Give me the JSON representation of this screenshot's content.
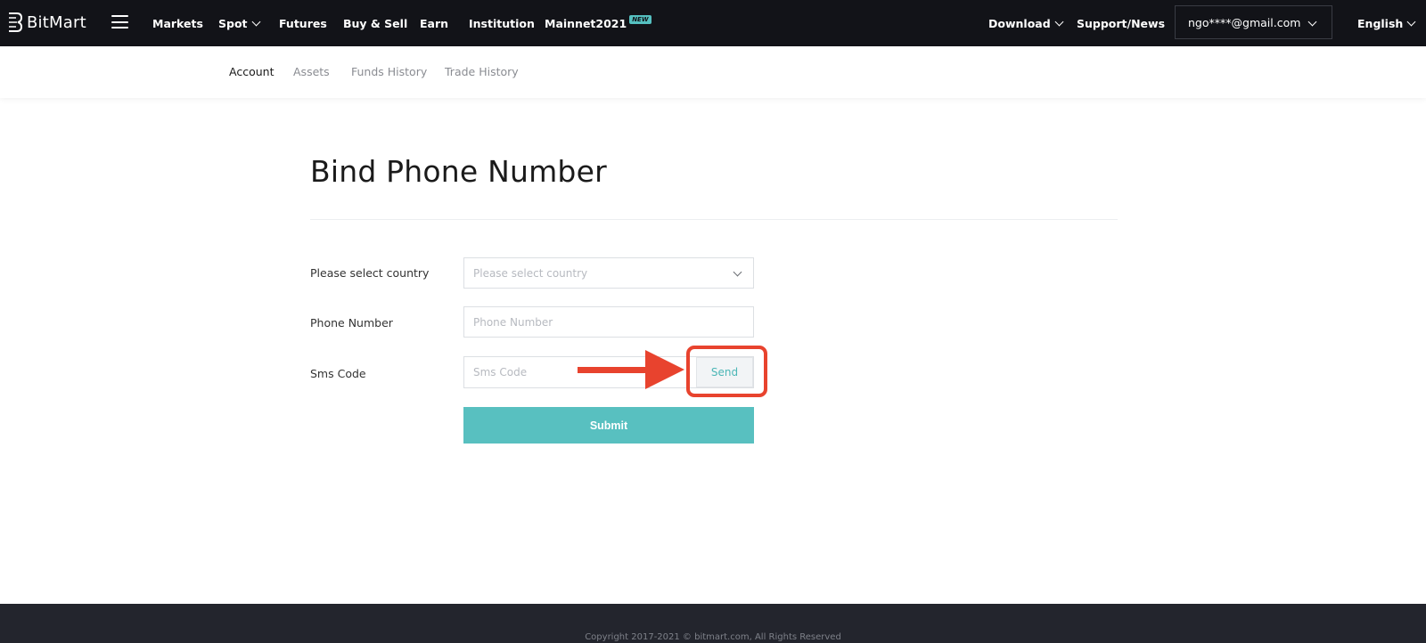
{
  "brand": {
    "name": "BitMart"
  },
  "topnav": {
    "items": [
      {
        "label": "Markets"
      },
      {
        "label": "Spot"
      },
      {
        "label": "Futures"
      },
      {
        "label": "Buy & Sell"
      },
      {
        "label": "Earn"
      },
      {
        "label": "Institution"
      },
      {
        "label": "Mainnet2021",
        "badge": "NEW"
      }
    ],
    "right": {
      "download": "Download",
      "support": "Support/News",
      "account": "ngo****@gmail.com",
      "language": "English"
    }
  },
  "subnav": {
    "items": [
      {
        "label": "Account",
        "active": true
      },
      {
        "label": "Assets"
      },
      {
        "label": "Funds History"
      },
      {
        "label": "Trade History"
      }
    ]
  },
  "form": {
    "title": "Bind Phone Number",
    "country_label": "Please select country",
    "country_placeholder": "Please select country",
    "phone_label": "Phone Number",
    "phone_placeholder": "Phone Number",
    "sms_label": "Sms Code",
    "sms_placeholder": "Sms Code",
    "send_label": "Send",
    "submit_label": "Submit"
  },
  "footer": {
    "copyright": "Copyright 2017-2021 © bitmart.com, All Rights Reserved"
  },
  "colors": {
    "nav_bg": "#121318",
    "accent": "#58c0c0",
    "annotation": "#e8432e",
    "footer_bg": "#23252d"
  },
  "icons": {
    "logo": "bitmart-logo-icon",
    "menu": "hamburger-menu-icon",
    "dropdown": "chevron-down-icon",
    "pointer": "red-arrow-annotation"
  }
}
